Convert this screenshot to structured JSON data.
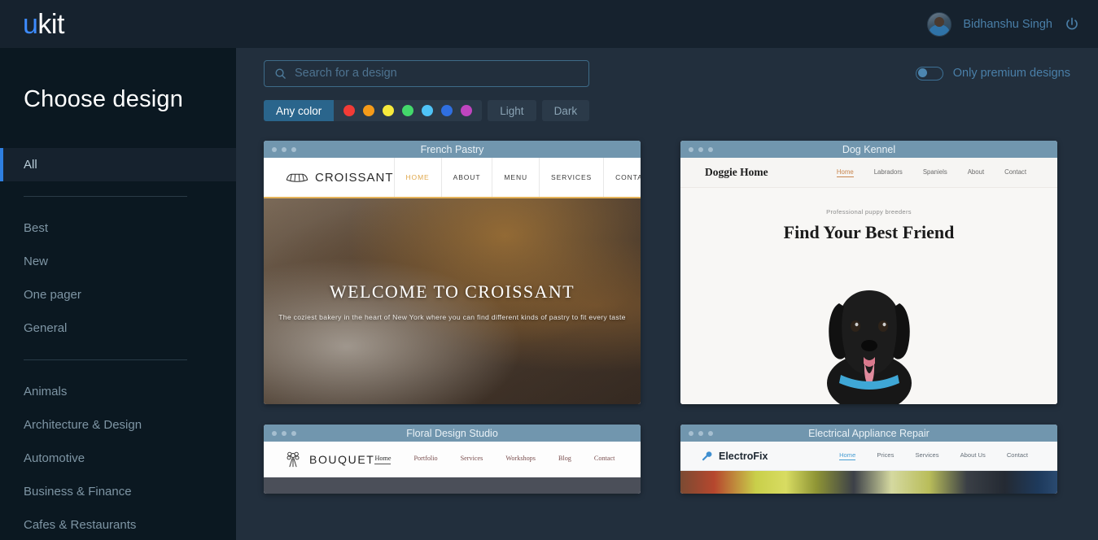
{
  "topbar": {
    "logo_u": "u",
    "logo_kit": "kit",
    "username": "Bidhanshu Singh",
    "power_icon": "power-icon",
    "avatar": "user-avatar"
  },
  "sidebar": {
    "title": "Choose design",
    "groups": [
      {
        "items": [
          {
            "label": "All",
            "active": true
          }
        ]
      },
      {
        "items": [
          {
            "label": "Best",
            "active": false
          },
          {
            "label": "New",
            "active": false
          },
          {
            "label": "One pager",
            "active": false
          },
          {
            "label": "General",
            "active": false
          }
        ]
      },
      {
        "items": [
          {
            "label": "Animals",
            "active": false
          },
          {
            "label": "Architecture & Design",
            "active": false
          },
          {
            "label": "Automotive",
            "active": false
          },
          {
            "label": "Business & Finance",
            "active": false
          },
          {
            "label": "Cafes & Restaurants",
            "active": false
          }
        ]
      }
    ]
  },
  "search": {
    "placeholder": "Search for a design",
    "value": "",
    "icon": "search-icon"
  },
  "premium": {
    "label": "Only premium designs",
    "enabled": false
  },
  "filters": {
    "any_color_label": "Any color",
    "any_color_selected": true,
    "colors": [
      {
        "name": "red",
        "hex": "#f23b36"
      },
      {
        "name": "orange",
        "hex": "#f59b19"
      },
      {
        "name": "yellow",
        "hex": "#f7ea3c"
      },
      {
        "name": "green",
        "hex": "#43d96b"
      },
      {
        "name": "light-blue",
        "hex": "#4fc3f7"
      },
      {
        "name": "blue",
        "hex": "#2f6fe0"
      },
      {
        "name": "magenta",
        "hex": "#c045c0"
      }
    ],
    "light_label": "Light",
    "dark_label": "Dark"
  },
  "designs": [
    {
      "title": "French Pastry",
      "site_name": "CROISSANT",
      "nav": [
        {
          "label": "HOME",
          "active": true
        },
        {
          "label": "ABOUT",
          "active": false
        },
        {
          "label": "MENU",
          "active": false
        },
        {
          "label": "SERVICES",
          "active": false
        },
        {
          "label": "CONTACT",
          "active": false
        }
      ],
      "heading": "WELCOME TO CROISSANT",
      "subheading": "The coziest bakery in the heart of New York where you can find different kinds of pastry to fit every taste"
    },
    {
      "title": "Dog Kennel",
      "site_name": "Doggie Home",
      "nav": [
        {
          "label": "Home",
          "active": true
        },
        {
          "label": "Labradors",
          "active": false
        },
        {
          "label": "Spaniels",
          "active": false
        },
        {
          "label": "About",
          "active": false
        },
        {
          "label": "Contact",
          "active": false
        }
      ],
      "kicker": "Professional puppy breeders",
      "heading": "Find Your Best Friend"
    },
    {
      "title": "Floral Design Studio",
      "site_name": "BOUQUET",
      "nav": [
        {
          "label": "Home",
          "active": true
        },
        {
          "label": "Portfolio",
          "active": false
        },
        {
          "label": "Services",
          "active": false
        },
        {
          "label": "Workshops",
          "active": false
        },
        {
          "label": "Blog",
          "active": false
        },
        {
          "label": "Contact",
          "active": false
        }
      ]
    },
    {
      "title": "Electrical Appliance Repair",
      "site_name": "ElectroFix",
      "nav": [
        {
          "label": "Home",
          "active": true
        },
        {
          "label": "Prices",
          "active": false
        },
        {
          "label": "Services",
          "active": false
        },
        {
          "label": "About Us",
          "active": false
        },
        {
          "label": "Contact",
          "active": false
        }
      ]
    }
  ],
  "colors": {
    "accent": "#2e7fe0",
    "topbar_bg": "#16222e",
    "sidebar_bg": "#0b1821",
    "main_bg": "#222f3d",
    "card_bar": "#7196ae",
    "link": "#4a7fa8"
  }
}
